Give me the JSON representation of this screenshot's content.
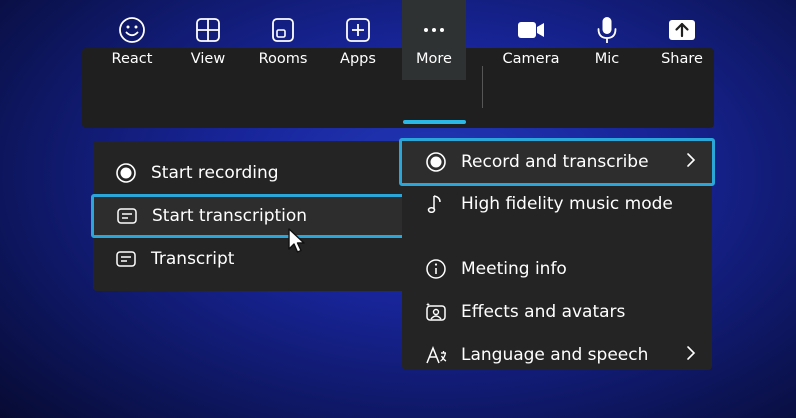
{
  "toolbar": {
    "items": [
      {
        "label": "React",
        "icon": "smile-icon"
      },
      {
        "label": "View",
        "icon": "grid-icon"
      },
      {
        "label": "Rooms",
        "icon": "rooms-icon"
      },
      {
        "label": "Apps",
        "icon": "plus-square-icon"
      },
      {
        "label": "More",
        "icon": "ellipsis-icon",
        "active": true
      },
      {
        "label": "Camera",
        "icon": "camera-icon"
      },
      {
        "label": "Mic",
        "icon": "mic-icon"
      },
      {
        "label": "Share",
        "icon": "share-icon"
      }
    ]
  },
  "more_menu": {
    "items": [
      {
        "label": "Record and transcribe",
        "icon": "record-icon",
        "submenu": true,
        "highlighted": true
      },
      {
        "label": "High fidelity music mode",
        "icon": "music-note-icon"
      },
      {
        "label": "Meeting info",
        "icon": "info-icon"
      },
      {
        "label": "Effects and avatars",
        "icon": "effects-icon"
      },
      {
        "label": "Language and speech",
        "icon": "language-icon",
        "submenu": true
      }
    ]
  },
  "record_submenu": {
    "items": [
      {
        "label": "Start recording",
        "icon": "record-icon"
      },
      {
        "label": "Start transcription",
        "icon": "transcript-icon",
        "highlighted": true
      },
      {
        "label": "Transcript",
        "icon": "transcript-icon"
      }
    ]
  },
  "colors": {
    "accent": "#2aa7d8",
    "toolbar_bg": "#1f1f1f",
    "menu_bg": "#242424",
    "background": "#18259a"
  }
}
